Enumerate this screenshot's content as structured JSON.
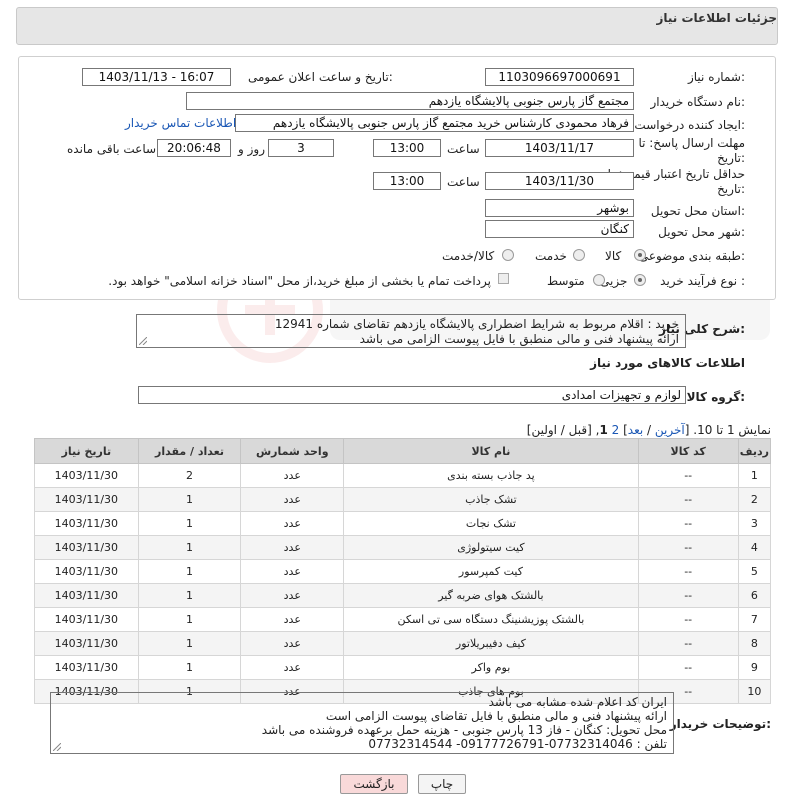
{
  "header": {
    "title": "جزئیات اطلاعات نیاز"
  },
  "fields": {
    "need_number_label": "شماره نیاز:",
    "need_number": "1103096697000691",
    "announce_label": "تاریخ و ساعت اعلان عمومی:",
    "announce_value": "1403/11/13 - 16:07",
    "buyer_org_label": "نام دستگاه خریدار:",
    "buyer_org": "مجتمع گاز پارس جنوبی  پالایشگاه یازدهم",
    "requester_label": "ایجاد کننده درخواست:",
    "requester": "فرهاد محمودی کارشناس خرید مجتمع گاز پارس جنوبی  پالایشگاه یازدهم",
    "contact_link": "اطلاعات تماس خریدار",
    "deadline_label_1": "مهلت ارسال پاسخ: تا",
    "deadline_label_2": "تاریخ:",
    "deadline_date": "1403/11/17",
    "time_label": "ساعت",
    "deadline_time": "13:00",
    "days": "3",
    "days_label": "روز و",
    "remaining": "20:06:48",
    "remaining_label": "ساعت باقی مانده",
    "validity_label_1": "حداقل تاریخ اعتبار قیمت: تا",
    "validity_label_2": "تاریخ:",
    "validity_date": "1403/11/30",
    "validity_time": "13:00",
    "province_label": "استان محل تحویل:",
    "province": "بوشهر",
    "city_label": "شهر محل تحویل:",
    "city": "کنگان",
    "category_label": "طبقه بندی موضوعی:",
    "category_options": [
      "کالا",
      "خدمت",
      "کالا/خدمت"
    ],
    "process_label": "نوع فرآیند خرید :",
    "process_options": [
      "جزیی",
      "متوسط"
    ],
    "payment_note": "پرداخت تمام یا بخشی از مبلغ خرید،از محل \"اسناد خزانه اسلامی\" خواهد بود."
  },
  "description": {
    "label": "شرح کلی نیاز:",
    "line1": "خرید :  اقلام مربوط به شرایط اضطراری پالایشگاه یازدهم تقاضای شماره 12941",
    "line2": "ارائه پیشنهاد فنی و مالی منطبق با فایل پیوست الزامی می باشد"
  },
  "goods_section": {
    "title": "اطلاعات کالاهای مورد نیاز",
    "group_label": "گروه کالا:",
    "group_value": "لوازم و تجهیزات امدادی"
  },
  "pagination": {
    "prefix": "نمایش 1 تا 10. [",
    "last": "آخرین",
    "sep1": " / ",
    "next": "بعد",
    "bracket_close": "]",
    "page2": "2",
    "page1": "1",
    "suffix": "[قبل / اولین]"
  },
  "table": {
    "headers": [
      "ردیف",
      "کد کالا",
      "نام کالا",
      "واحد شمارش",
      "تعداد / مقدار",
      "تاریخ نیاز"
    ],
    "rows": [
      [
        "1",
        "--",
        "پد جاذب بسته بندی",
        "عدد",
        "2",
        "1403/11/30"
      ],
      [
        "2",
        "--",
        "تشک جاذب",
        "عدد",
        "1",
        "1403/11/30"
      ],
      [
        "3",
        "--",
        "تشک نجات",
        "عدد",
        "1",
        "1403/11/30"
      ],
      [
        "4",
        "--",
        "کیت سیتولوژی",
        "عدد",
        "1",
        "1403/11/30"
      ],
      [
        "5",
        "--",
        "کیت کمپرسور",
        "عدد",
        "1",
        "1403/11/30"
      ],
      [
        "6",
        "--",
        "بالشتک هوای ضربه گیر",
        "عدد",
        "1",
        "1403/11/30"
      ],
      [
        "7",
        "--",
        "بالشتک پوزیشنینگ دستگاه سی تی اسکن",
        "عدد",
        "1",
        "1403/11/30"
      ],
      [
        "8",
        "--",
        "کیف دفیبریلاتور",
        "عدد",
        "1",
        "1403/11/30"
      ],
      [
        "9",
        "--",
        "بوم واکر",
        "عدد",
        "1",
        "1403/11/30"
      ],
      [
        "10",
        "--",
        "بوم های جاذب",
        "عدد",
        "1",
        "1403/11/30"
      ]
    ]
  },
  "buyer_notes": {
    "label": "توضیحات خریدار:",
    "lines": [
      "ایران کد اعلام شده مشابه می باشد",
      " ارائه پیشنهاد فنی و مالی منطبق با فایل تقاضای پیوست الزامی است",
      "محل تحویل: کنگان - فاز 13 پارس جنوبی - هزینه حمل برعهده فروشنده می باشد",
      "تلفن : 07732314046-09177726791- 07732314544"
    ]
  },
  "buttons": {
    "print": "چاپ",
    "back": "بازگشت"
  },
  "colors": {
    "header_bg": "#e6e6e6",
    "link": "#1a57b5",
    "back_button": "#f9d9d9"
  }
}
